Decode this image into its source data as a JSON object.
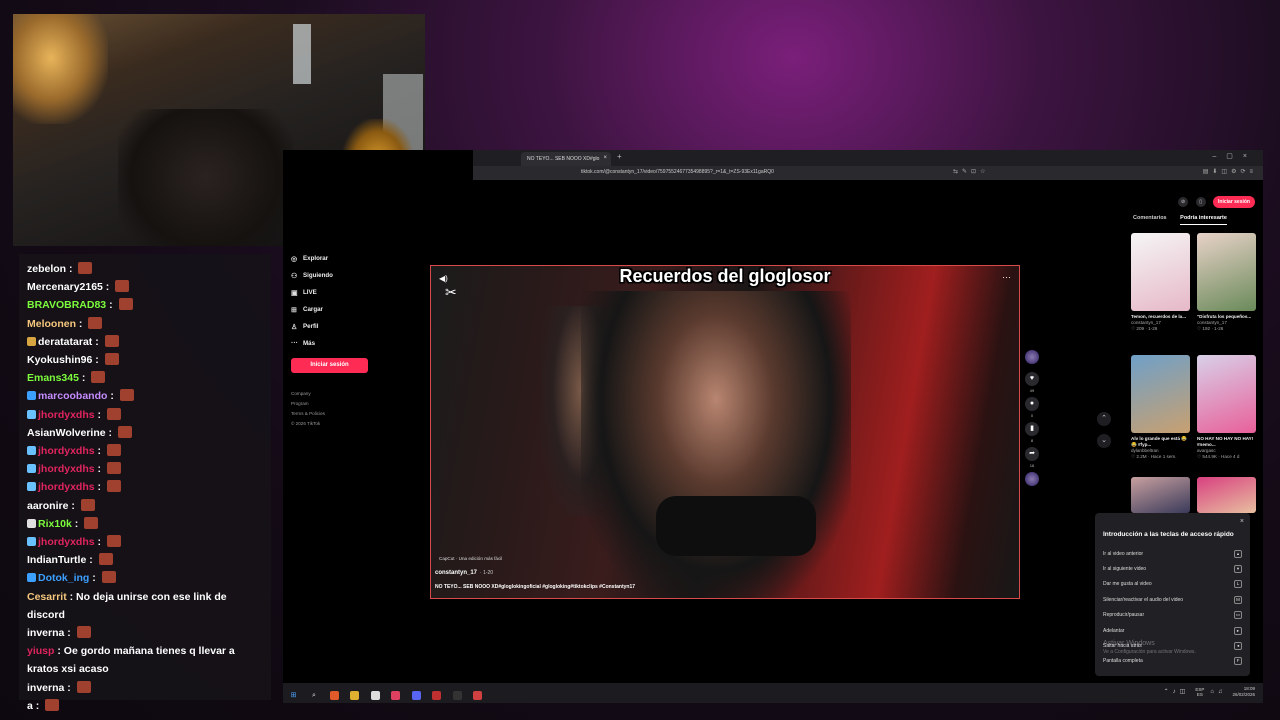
{
  "chat": {
    "lines": [
      {
        "user": "zebelon",
        "color": "#ffffff",
        "msg": "",
        "badge": ""
      },
      {
        "user": "Mercenary2165",
        "color": "#ffffff",
        "msg": "",
        "badge": ""
      },
      {
        "user": "BRAVOBRAD83",
        "color": "#7cfc3c",
        "msg": "",
        "badge": ""
      },
      {
        "user": "Meloonen",
        "color": "#f5c77e",
        "msg": "",
        "badge": ""
      },
      {
        "user": "deratatarat",
        "color": "#ffffff",
        "msg": "",
        "badge": "#d8a640"
      },
      {
        "user": "Kyokushin96",
        "color": "#ffffff",
        "msg": "",
        "badge": ""
      },
      {
        "user": "Emans345",
        "color": "#7cfc3c",
        "msg": "",
        "badge": ""
      },
      {
        "user": "marcoobando",
        "color": "#c58cff",
        "msg": "",
        "badge": "#3ca0ff"
      },
      {
        "user": "jhordyxdhs",
        "color": "#e0245e",
        "msg": "",
        "badge": "#6ac1ff"
      },
      {
        "user": "AsianWolverine",
        "color": "#ffffff",
        "msg": "",
        "badge": ""
      },
      {
        "user": "jhordyxdhs",
        "color": "#e0245e",
        "msg": "",
        "badge": "#6ac1ff"
      },
      {
        "user": "jhordyxdhs",
        "color": "#e0245e",
        "msg": "",
        "badge": "#6ac1ff"
      },
      {
        "user": "jhordyxdhs",
        "color": "#e0245e",
        "msg": "",
        "badge": "#6ac1ff"
      },
      {
        "user": "aaronire",
        "color": "#ffffff",
        "msg": "",
        "badge": ""
      },
      {
        "user": "Rix10k",
        "color": "#7cfc3c",
        "msg": "",
        "badge": "#e0e0e0"
      },
      {
        "user": "jhordyxdhs",
        "color": "#e0245e",
        "msg": "",
        "badge": "#6ac1ff"
      },
      {
        "user": "IndianTurtle",
        "color": "#ffffff",
        "msg": "",
        "badge": ""
      },
      {
        "user": "Dotok_ing",
        "color": "#3ca0ff",
        "msg": "",
        "badge": "#3ca0ff"
      },
      {
        "user": "Cesarrit",
        "color": "#f5c77e",
        "msg": "No deja unirse con ese link de discord",
        "badge": ""
      },
      {
        "user": "inverna",
        "color": "#ffffff",
        "msg": "",
        "badge": ""
      },
      {
        "user": "yiusp",
        "color": "#e0245e",
        "msg": "Oe gordo mañana tienes q llevar a kratos xsi acaso",
        "badge": ""
      },
      {
        "user": "inverna",
        "color": "#ffffff",
        "msg": "",
        "badge": ""
      },
      {
        "user": "a",
        "color": "#ffffff",
        "msg": "",
        "badge": ""
      }
    ]
  },
  "browser": {
    "tab_title": "NO TEYO... SEB NOOO XD#glo",
    "url": "tiktok.com/@constantyn_17/video/7597552467735498895?_r=1&_t=ZS-93Ex11gaRQ0"
  },
  "sidebar": {
    "items": [
      {
        "icon": "◎",
        "label": "Explorar"
      },
      {
        "icon": "⚇",
        "label": "Siguiendo"
      },
      {
        "icon": "▣",
        "label": "LIVE"
      },
      {
        "icon": "⊞",
        "label": "Cargar"
      },
      {
        "icon": "♙",
        "label": "Perfil"
      },
      {
        "icon": "···",
        "label": "Más"
      }
    ],
    "login": "Iniciar sesión",
    "footer": [
      "Company",
      "Program",
      "Terms & Policies",
      "© 2026 TikTok"
    ]
  },
  "video": {
    "overlay_title": "Recuerdos del gloglosor",
    "capcut_tag": "CapCut · Una edición más fácil",
    "author": "constantyn_17",
    "date": "· 1-20",
    "caption": "NO TEYO... SEB NOOO XD#gloglokingoficial #glogloking#tiktokclips #Constantyn17"
  },
  "actions": [
    {
      "icon": "♥",
      "count": "49"
    },
    {
      "icon": "●",
      "count": "0"
    },
    {
      "icon": "▮",
      "count": "8"
    },
    {
      "icon": "➦",
      "count": "16"
    }
  ],
  "right_panel": {
    "login": "Iniciar sesión",
    "tabs": [
      "Comentarios",
      "Podría interesarte"
    ],
    "cards": [
      {
        "caption": "Temon, recuerdos de la...",
        "user": "constantyn_17",
        "stats": "♡ 209 · 1-26",
        "colors": [
          "#f5f5f5",
          "#e6b8c8"
        ]
      },
      {
        "caption": "\"Disfruta los pequeños...",
        "user": "constantyn_17",
        "stats": "♡ 192 · 1-26",
        "colors": [
          "#e8d2c8",
          "#6a8a5a"
        ]
      },
      {
        "caption": "Alv lo grande que está 😂 😂 #fyp...",
        "user": "dylanbbeltran",
        "stats": "♡ 2.2M · Hace 1 sem.",
        "colors": [
          "#6fa0c8",
          "#c8a070"
        ]
      },
      {
        "caption": "NO HAY NO HAY NO HAY! #nemo...",
        "user": "avargasc",
        "stats": "♡ 544.9K · Hace 4 d",
        "colors": [
          "#d8d0e8",
          "#e8609a"
        ]
      },
      {
        "caption": "",
        "user": "",
        "stats": "",
        "colors": [
          "#c8a0a0",
          "#3a3a5a"
        ]
      },
      {
        "caption": "",
        "user": "",
        "stats": "",
        "colors": [
          "#d84080",
          "#e8c0a0"
        ]
      }
    ]
  },
  "shortcuts": {
    "title": "Introducción a las teclas de acceso rápido",
    "rows": [
      {
        "label": "Ir al video anterior",
        "key": "▴"
      },
      {
        "label": "Ir al siguiente video",
        "key": "▾"
      },
      {
        "label": "Dar me gusta al video",
        "key": "L"
      },
      {
        "label": "Silenciar/reactivar el audio del video",
        "key": "M"
      },
      {
        "label": "Reproducir/pausar",
        "key": "▭"
      },
      {
        "label": "Adelantar",
        "key": "▸"
      },
      {
        "label": "Saltar hacia atrás",
        "key": "◂"
      },
      {
        "label": "Pantalla completa",
        "key": "F"
      }
    ]
  },
  "activate_windows": {
    "title": "Activar Windows",
    "subtitle": "Ve a Configuración para activar Windows."
  },
  "taskbar": {
    "lang": [
      "ESP",
      "ES"
    ],
    "time": "18:09",
    "date": "26/02/2026"
  }
}
